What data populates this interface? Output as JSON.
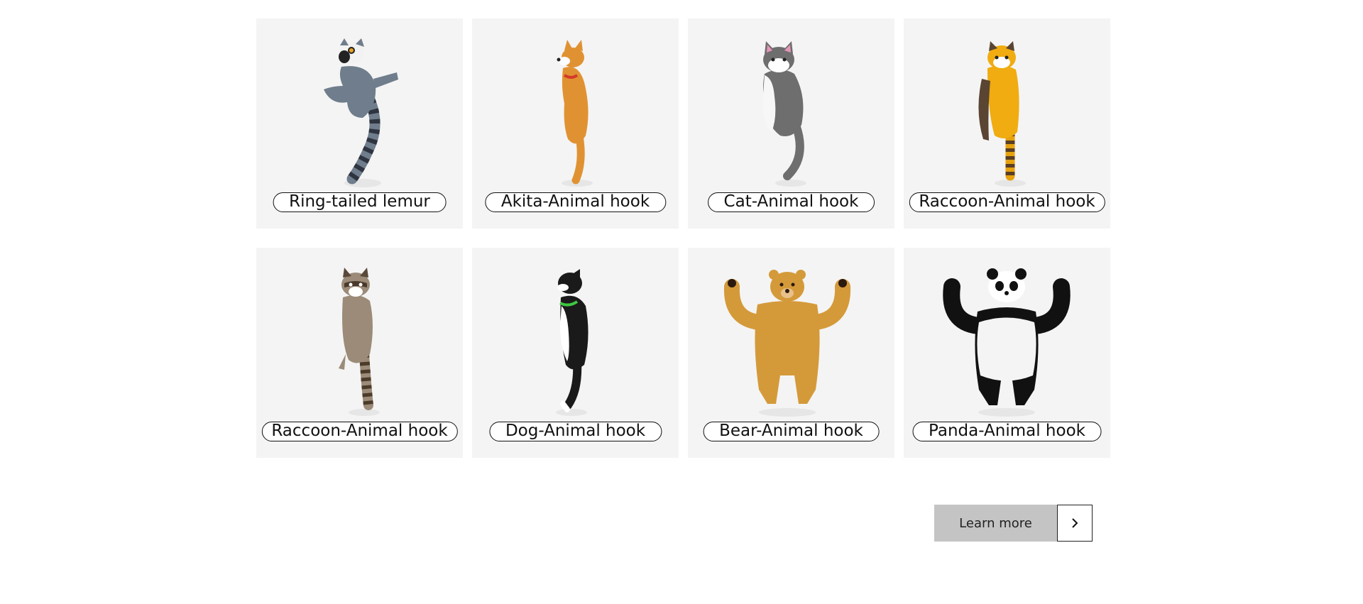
{
  "products": [
    {
      "label": "Ring-tailed lemur",
      "icon": "ring-tailed-lemur-hook-image"
    },
    {
      "label": "Akita-Animal hook",
      "icon": "akita-hook-image"
    },
    {
      "label": "Cat-Animal hook",
      "icon": "cat-hook-image"
    },
    {
      "label": "Raccoon-Animal hook",
      "icon": "red-panda-hook-image"
    },
    {
      "label": "Raccoon-Animal hook",
      "icon": "raccoon-hook-image"
    },
    {
      "label": "Dog-Animal hook",
      "icon": "dog-hook-image"
    },
    {
      "label": "Bear-Animal hook",
      "icon": "bear-hook-image"
    },
    {
      "label": "Panda-Animal hook",
      "icon": "panda-hook-image"
    }
  ],
  "cta": {
    "learn_more_label": "Learn more",
    "next_icon": "chevron-right-icon"
  },
  "colors": {
    "card_background": "#f4f4f4",
    "button_background": "#c4c4c4",
    "border": "#111111"
  }
}
